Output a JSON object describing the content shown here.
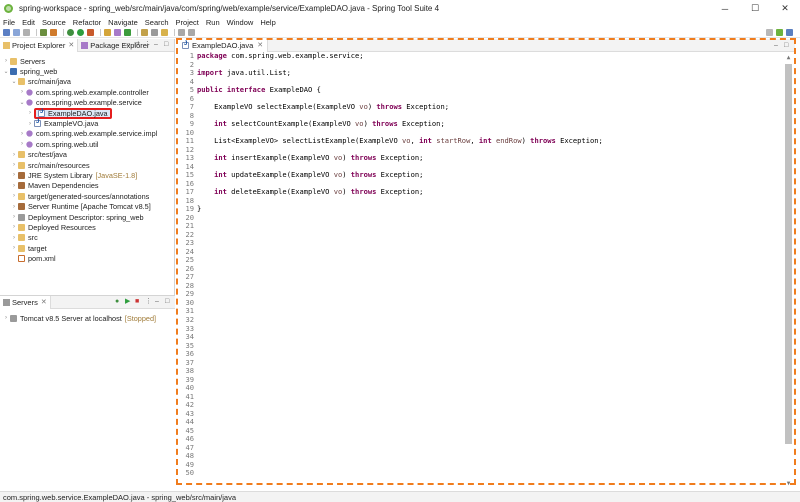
{
  "window": {
    "title": "spring-workspace - spring_web/src/main/java/com/spring/web/example/service/ExampleDAO.java - Spring Tool Suite 4",
    "minimize": "─",
    "maximize": "☐",
    "close": "✕"
  },
  "menu": [
    "File",
    "Edit",
    "Source",
    "Refactor",
    "Navigate",
    "Search",
    "Project",
    "Run",
    "Window",
    "Help"
  ],
  "left_views": {
    "tabs": [
      {
        "label": "Project Explorer",
        "active": true
      },
      {
        "label": "Package Explorer",
        "active": false
      }
    ],
    "close_glyph": "✕"
  },
  "tree": {
    "servers": "Servers",
    "project": "spring_web",
    "src_main_java": "src/main/java",
    "pkg_controller": "com.spring.web.example.controller",
    "pkg_service": "com.spring.web.example.service",
    "file_dao": "ExampleDAO.java",
    "file_vo": "ExampleVO.java",
    "pkg_service_impl": "com.spring.web.example.service.impl",
    "pkg_util": "com.spring.web.util",
    "src_test_java": "src/test/java",
    "src_main_resources": "src/main/resources",
    "jre": "JRE System Library",
    "jre_tag": "[JavaSE-1.8]",
    "maven": "Maven Dependencies",
    "target_gen": "target/generated-sources/annotations",
    "server_runtime": "Server Runtime [Apache Tomcat v8.5]",
    "deploy_desc": "Deployment Descriptor: spring_web",
    "deployed": "Deployed Resources",
    "src": "src",
    "target": "target",
    "pom": "pom.xml"
  },
  "servers_view": {
    "tab": "Servers",
    "tomcat": "Tomcat v8.5 Server at localhost",
    "state": "[Stopped]"
  },
  "editor": {
    "tab": "ExampleDAO.java",
    "line_count": 50,
    "code": [
      [
        {
          "t": "kw",
          "v": "package"
        },
        {
          "t": "n",
          "v": " com.spring.web.example.service;"
        }
      ],
      [],
      [
        {
          "t": "kw",
          "v": "import"
        },
        {
          "t": "n",
          "v": " java.util.List;"
        }
      ],
      [],
      [
        {
          "t": "kw",
          "v": "public"
        },
        {
          "t": "n",
          "v": " "
        },
        {
          "t": "kw",
          "v": "interface"
        },
        {
          "t": "n",
          "v": " ExampleDAO {"
        }
      ],
      [],
      [
        {
          "t": "n",
          "v": "    ExampleVO selectExample(ExampleVO "
        },
        {
          "t": "pm",
          "v": "vo"
        },
        {
          "t": "n",
          "v": ") "
        },
        {
          "t": "kw",
          "v": "throws"
        },
        {
          "t": "n",
          "v": " Exception;"
        }
      ],
      [],
      [
        {
          "t": "n",
          "v": "    "
        },
        {
          "t": "kw",
          "v": "int"
        },
        {
          "t": "n",
          "v": " selectCountExample(ExampleVO "
        },
        {
          "t": "pm",
          "v": "vo"
        },
        {
          "t": "n",
          "v": ") "
        },
        {
          "t": "kw",
          "v": "throws"
        },
        {
          "t": "n",
          "v": " Exception;"
        }
      ],
      [],
      [
        {
          "t": "n",
          "v": "    List<ExampleVO> selectListExample(ExampleVO "
        },
        {
          "t": "pm",
          "v": "vo"
        },
        {
          "t": "n",
          "v": ", "
        },
        {
          "t": "kw",
          "v": "int"
        },
        {
          "t": "n",
          "v": " "
        },
        {
          "t": "pm",
          "v": "startRow"
        },
        {
          "t": "n",
          "v": ", "
        },
        {
          "t": "kw",
          "v": "int"
        },
        {
          "t": "n",
          "v": " "
        },
        {
          "t": "pm",
          "v": "endRow"
        },
        {
          "t": "n",
          "v": ") "
        },
        {
          "t": "kw",
          "v": "throws"
        },
        {
          "t": "n",
          "v": " Exception;"
        }
      ],
      [],
      [
        {
          "t": "n",
          "v": "    "
        },
        {
          "t": "kw",
          "v": "int"
        },
        {
          "t": "n",
          "v": " insertExample(ExampleVO "
        },
        {
          "t": "pm",
          "v": "vo"
        },
        {
          "t": "n",
          "v": ") "
        },
        {
          "t": "kw",
          "v": "throws"
        },
        {
          "t": "n",
          "v": " Exception;"
        }
      ],
      [],
      [
        {
          "t": "n",
          "v": "    "
        },
        {
          "t": "kw",
          "v": "int"
        },
        {
          "t": "n",
          "v": " updateExample(ExampleVO "
        },
        {
          "t": "pm",
          "v": "vo"
        },
        {
          "t": "n",
          "v": ") "
        },
        {
          "t": "kw",
          "v": "throws"
        },
        {
          "t": "n",
          "v": " Exception;"
        }
      ],
      [],
      [
        {
          "t": "n",
          "v": "    "
        },
        {
          "t": "kw",
          "v": "int"
        },
        {
          "t": "n",
          "v": " deleteExample(ExampleVO "
        },
        {
          "t": "pm",
          "v": "vo"
        },
        {
          "t": "n",
          "v": ") "
        },
        {
          "t": "kw",
          "v": "throws"
        },
        {
          "t": "n",
          "v": " Exception;"
        }
      ],
      [],
      [
        {
          "t": "n",
          "v": "}"
        }
      ]
    ]
  },
  "status": {
    "text": "com.spring.web.service.ExampleDAO.java - spring_web/src/main/java"
  },
  "colors": {
    "keyword": "#7f0055",
    "param": "#6a3e3e",
    "selection_outline": "#e41d1d",
    "editor_highlight": "#f07c1d"
  }
}
